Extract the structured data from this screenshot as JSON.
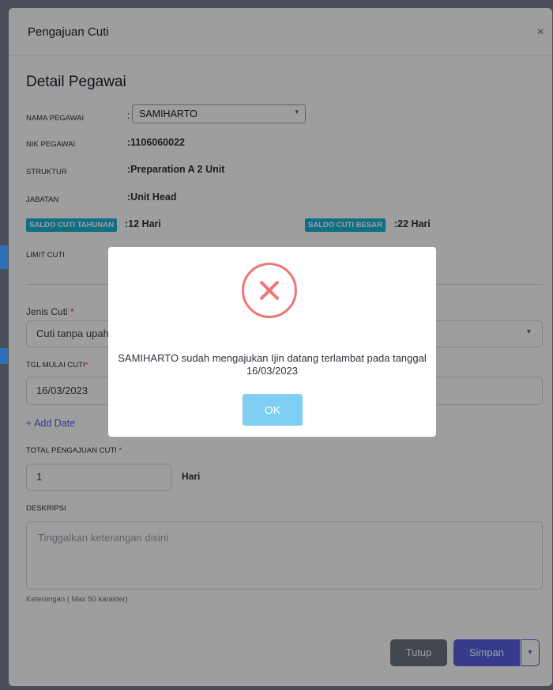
{
  "modal": {
    "title": "Pengajuan Cuti",
    "close_glyph": "×",
    "section_title": "Detail Pegawai"
  },
  "employee": {
    "nama_label": "NAMA PEGAWAI",
    "nama_value": "SAMIHARTO",
    "nik_label": "NIK PEGAWAI",
    "nik_value": ":1106060022",
    "struktur_label": "STRUKTUR",
    "struktur_value": ":Preparation A 2 Unit",
    "jabatan_label": "JABATAN",
    "jabatan_value": ":Unit Head",
    "saldo_tahunan_badge": "SALDO CUTI TAHUNAN",
    "saldo_tahunan_value": ":12 Hari",
    "saldo_besar_badge": "SALDO CUTI BESAR",
    "saldo_besar_value": ":22 Hari",
    "limit_label": "LIMIT CUTI"
  },
  "form": {
    "jenis_label": "Jenis Cuti",
    "jenis_value": "Cuti tanpa upah",
    "tgl_label": "TGL MULAI CUTI",
    "tgl_value": "16/03/2023",
    "add_date": "+ Add Date",
    "total_label": "TOTAL PENGAJUAN CUTI",
    "total_value": "1",
    "total_unit": "Hari",
    "deskripsi_label": "DESKRIPSI",
    "deskripsi_placeholder": "Tinggalkan keterangan disini",
    "deskripsi_hint": "Keterangan ( Max 50 karakter)",
    "required_mark": "*"
  },
  "footer": {
    "tutup": "Tutup",
    "simpan": "Simpan"
  },
  "dialog": {
    "message": "SAMIHARTO sudah mengajukan Ijin datang terlambat pada tanggal 16/03/2023",
    "ok": "OK",
    "icon": "error-x-icon"
  },
  "colors": {
    "badge": "#1bb3d6",
    "primary": "#5b5fe0",
    "error": "#f27474",
    "ok_button": "#7ecff3"
  }
}
